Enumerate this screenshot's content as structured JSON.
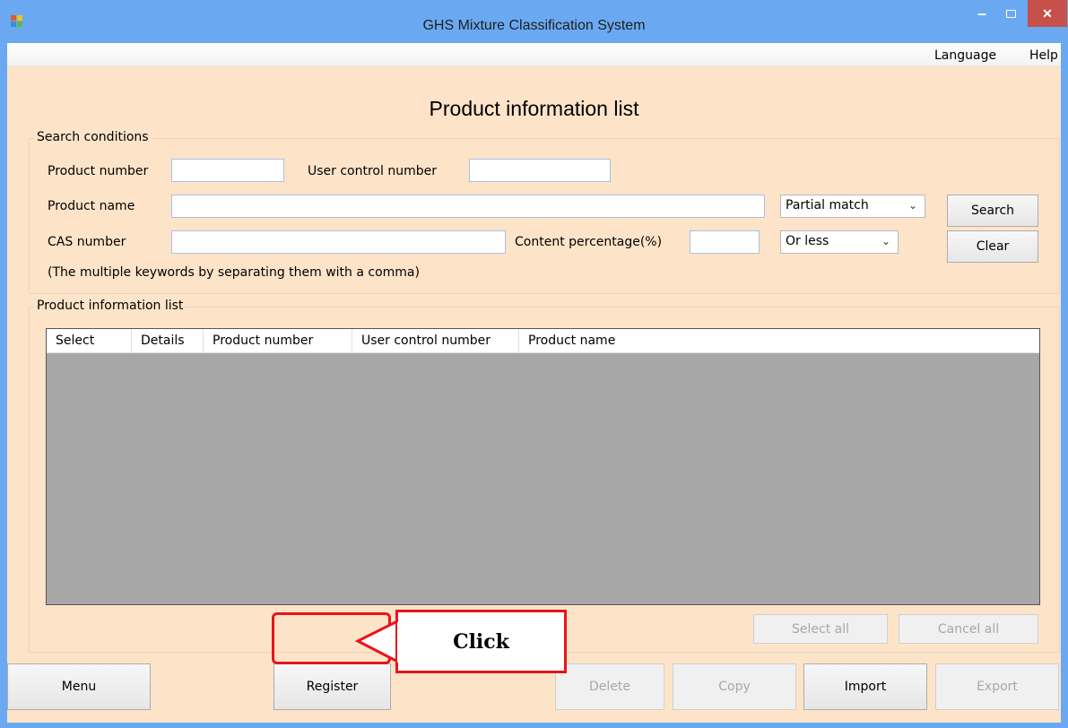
{
  "window": {
    "title": "GHS Mixture Classification System",
    "minimize_glyph": "–",
    "close_glyph": "✕"
  },
  "menubar": {
    "items": [
      "Language",
      "Help"
    ]
  },
  "heading": "Product information list",
  "search": {
    "group_label": "Search conditions",
    "product_number_label": "Product number",
    "product_number_value": "",
    "user_control_number_label": "User control number",
    "user_control_number_value": "",
    "product_name_label": "Product name",
    "product_name_value": "",
    "match_mode": "Partial match",
    "cas_number_label": "CAS number",
    "cas_number_value": "",
    "content_percentage_label": "Content percentage(%)",
    "content_percentage_value": "",
    "comparison": "Or less",
    "hint": "(The multiple keywords by separating them with a comma)",
    "search_button": "Search",
    "clear_button": "Clear"
  },
  "list": {
    "group_label": "Product information list",
    "columns": [
      "Select",
      "Details",
      "Product number",
      "User control number",
      "Product name"
    ],
    "select_all_button": "Select all",
    "cancel_all_button": "Cancel all"
  },
  "footer": {
    "menu_button": "Menu",
    "register_button": "Register",
    "delete_button": "Delete",
    "copy_button": "Copy",
    "import_button": "Import",
    "export_button": "Export"
  },
  "annotation": {
    "callout_text": "Click",
    "color": "#e8141b"
  },
  "colors": {
    "titlebar": "#6aa9f1",
    "client_background": "#fde4c9",
    "grid_background": "#a7a7a7",
    "close_button": "#c7504a"
  }
}
